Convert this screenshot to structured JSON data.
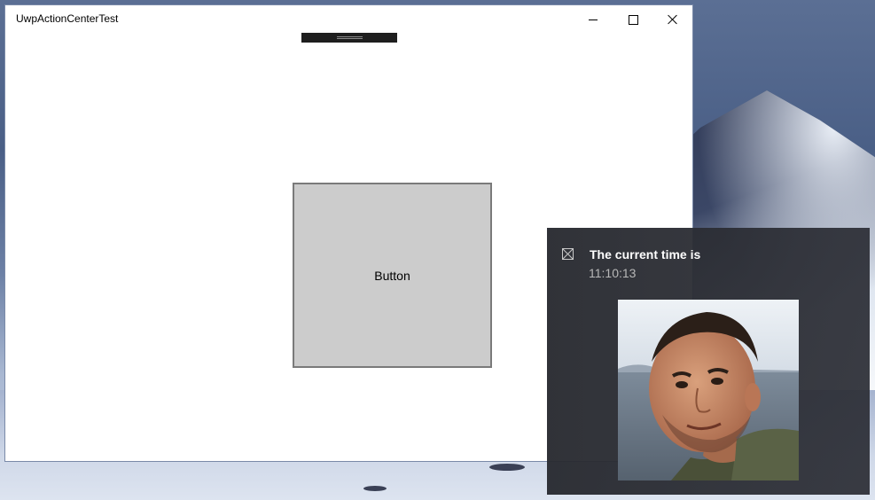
{
  "window": {
    "title": "UwpActionCenterTest"
  },
  "main": {
    "button_label": "Button"
  },
  "toast": {
    "title": "The current time is",
    "body": "11:10:13",
    "image_icon": "broken-image-icon",
    "image_subject": "portrait photo of a man by the sea"
  },
  "colors": {
    "toast_background": "#2d2f36",
    "button_background": "#cccccc"
  }
}
